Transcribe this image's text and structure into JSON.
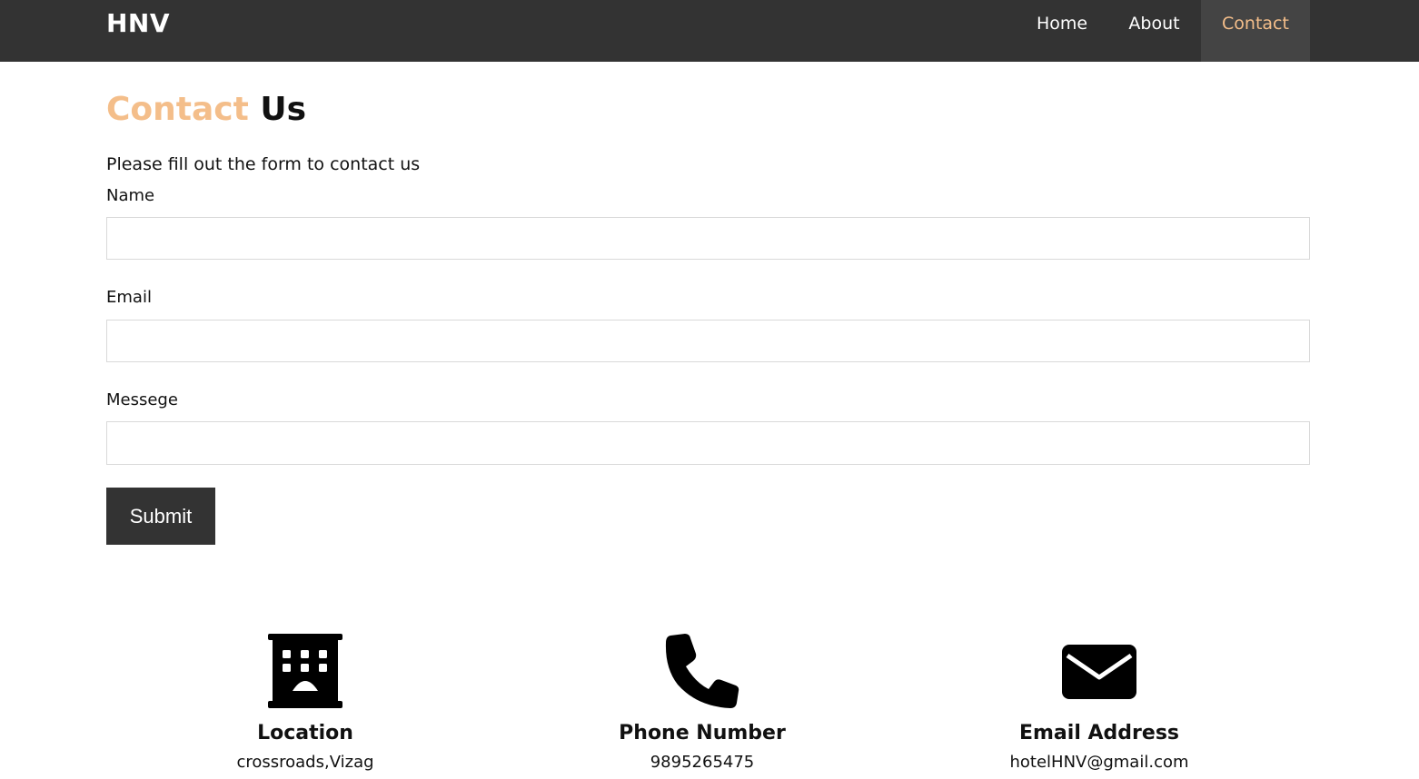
{
  "brand": "HNV",
  "nav": {
    "home": "Home",
    "about": "About",
    "contact": "Contact"
  },
  "title": {
    "accent": "Contact",
    "rest": "Us"
  },
  "form": {
    "intro": "Please fill out the form to contact us",
    "name_label": "Name",
    "email_label": "Email",
    "message_label": "Messege",
    "submit_label": "Submit"
  },
  "info": {
    "location": {
      "icon": "building-icon",
      "title": "Location",
      "value": "crossroads,Vizag"
    },
    "phone": {
      "icon": "phone-icon",
      "title": "Phone Number",
      "value": "9895265475"
    },
    "email": {
      "icon": "envelope-icon",
      "title": "Email Address",
      "value": "hotelHNV@gmail.com"
    }
  },
  "colors": {
    "navbar": "#333333",
    "active_tab_bg": "#444444",
    "accent": "#f4be8a",
    "button": "#333333"
  }
}
